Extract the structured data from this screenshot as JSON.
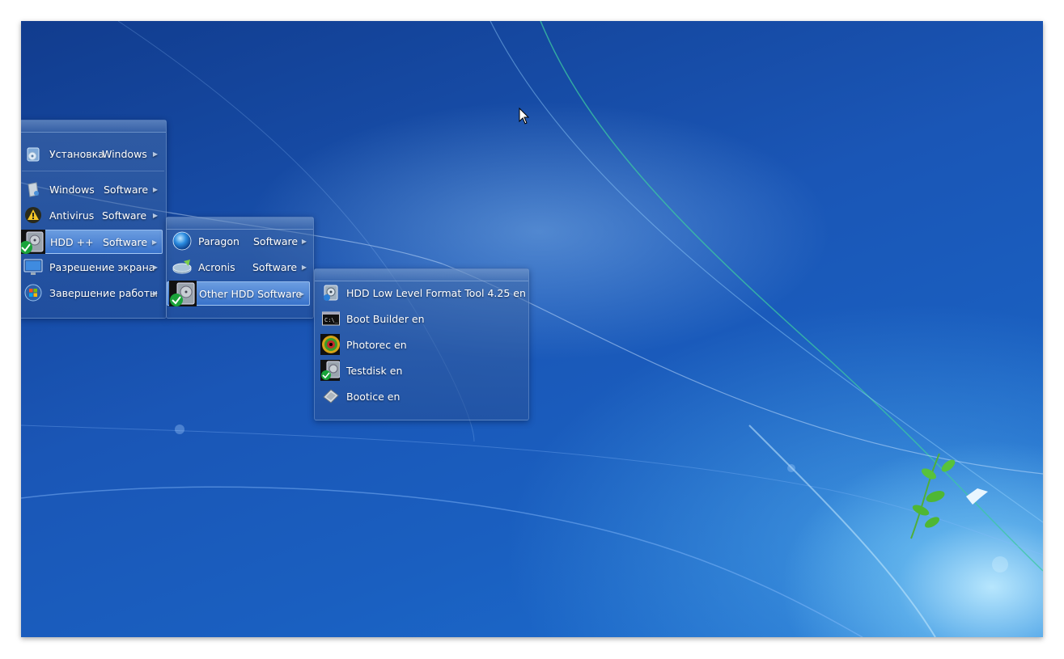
{
  "main_menu": {
    "items": [
      {
        "label": "Установка",
        "label2": "Windows",
        "icon": "install-disc-icon"
      },
      {
        "label": "Windows",
        "label2": "Software",
        "icon": "windows-box-icon"
      },
      {
        "label": "Antivirus",
        "label2": "Software",
        "icon": "antivirus-warning-icon"
      },
      {
        "label": "HDD ++",
        "label2": "Software",
        "icon": "hdd-tool-icon"
      },
      {
        "label": "Разрешение экрана",
        "label2": "",
        "icon": "monitor-icon"
      },
      {
        "label": "Завершение работы",
        "label2": "",
        "icon": "windows-orb-icon"
      }
    ]
  },
  "hdd_submenu": {
    "items": [
      {
        "label": "Paragon",
        "label2": "Software",
        "icon": "paragon-globe-icon"
      },
      {
        "label": "Acronis",
        "label2": "Software",
        "icon": "acronis-disk-icon"
      },
      {
        "label": "Other HDD Software",
        "label2": "",
        "icon": "hdd-tool-icon"
      }
    ]
  },
  "other_hdd_submenu": {
    "items": [
      {
        "label": "HDD Low Level Format Tool 4.25 en",
        "icon": "format-tool-icon"
      },
      {
        "label": "Boot Builder en",
        "icon": "console-icon"
      },
      {
        "label": "Photorec en",
        "icon": "photorec-icon"
      },
      {
        "label": "Testdisk en",
        "icon": "testdisk-icon"
      },
      {
        "label": "Bootice en",
        "icon": "bootice-icon"
      }
    ]
  },
  "colors": {
    "accent": "#3f7fd6",
    "wallpaper": "#1a56b6"
  }
}
